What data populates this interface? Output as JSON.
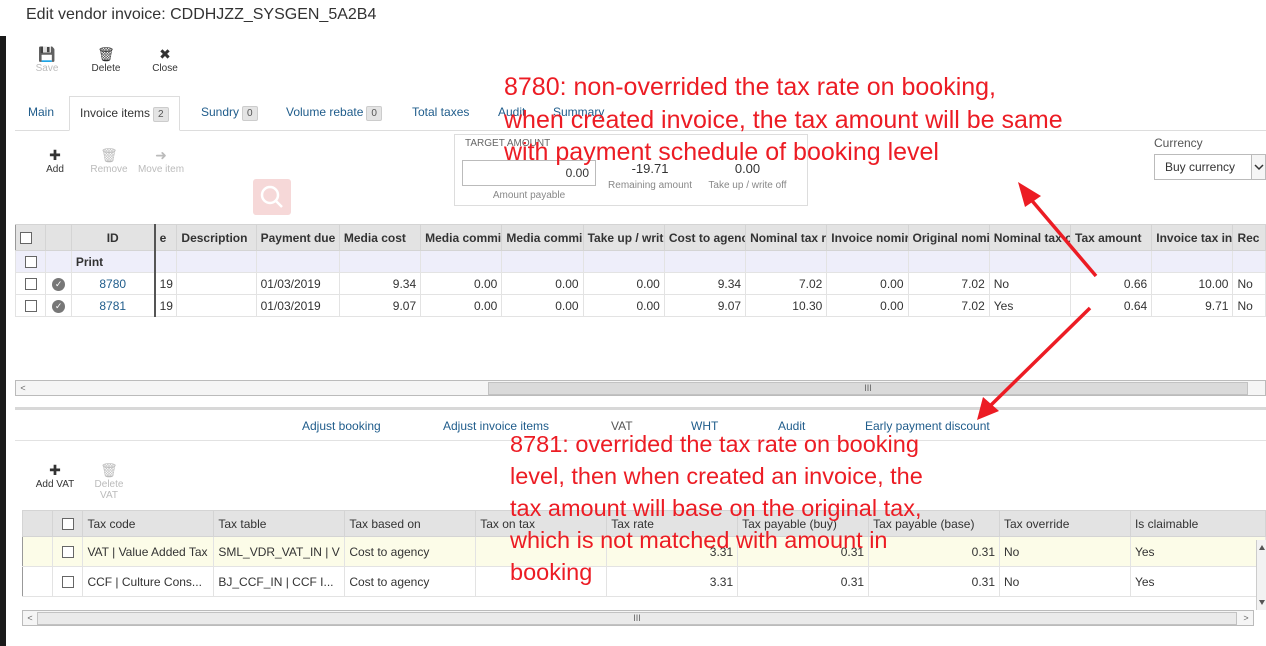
{
  "window": {
    "title": "Edit vendor invoice: CDDHJZZ_SYSGEN_5A2B4"
  },
  "toolbar": {
    "save": "Save",
    "delete": "Delete",
    "close": "Close"
  },
  "tabs": [
    {
      "label": "Main"
    },
    {
      "label": "Invoice items",
      "badge": "2"
    },
    {
      "label": "Sundry",
      "badge": "0"
    },
    {
      "label": "Volume rebate",
      "badge": "0"
    },
    {
      "label": "Total taxes"
    },
    {
      "label": "Audit"
    },
    {
      "label": "Summary"
    }
  ],
  "items_toolbar": {
    "add": "Add",
    "remove": "Remove",
    "move": "Move item"
  },
  "target": {
    "heading": "TARGET AMOUNT",
    "amount_payable_value": "0.00",
    "amount_payable_label": "Amount payable",
    "remaining_value": "-19.71",
    "remaining_label": "Remaining amount",
    "takeup_value": "0.00",
    "takeup_label": "Take up / write off"
  },
  "currency": {
    "label": "Currency",
    "selected": "Buy currency"
  },
  "grid1": {
    "headers": {
      "id": "ID",
      "e": "e",
      "description": "Description",
      "payment_due": "Payment due",
      "media_cost": "Media cost",
      "media_comm1": "Media commi",
      "media_comm2": "Media commi",
      "takeup": "Take up / writ",
      "cost_agency": "Cost to agenc",
      "nominal_tax_r": "Nominal tax r",
      "invoice_nominal": "Invoice nomir",
      "original_nominal": "Original nomi",
      "nominal_tax_o": "Nominal tax o",
      "tax_amount": "Tax amount",
      "invoice_tax_in": "Invoice tax in",
      "rec": "Rec"
    },
    "print_row": "Print",
    "rows": [
      {
        "id": "8780",
        "e": "19",
        "description": "",
        "payment_due": "01/03/2019",
        "media_cost": "9.34",
        "media_comm1": "0.00",
        "media_comm2": "0.00",
        "takeup": "0.00",
        "cost_agency": "9.34",
        "nominal_tax_r": "7.02",
        "invoice_nominal": "0.00",
        "original_nominal": "7.02",
        "nominal_tax_o": "No",
        "tax_amount": "0.66",
        "invoice_tax_in": "10.00",
        "rec": "No"
      },
      {
        "id": "8781",
        "e": "19",
        "description": "",
        "payment_due": "01/03/2019",
        "media_cost": "9.07",
        "media_comm1": "0.00",
        "media_comm2": "0.00",
        "takeup": "0.00",
        "cost_agency": "9.07",
        "nominal_tax_r": "10.30",
        "invoice_nominal": "0.00",
        "original_nominal": "7.02",
        "nominal_tax_o": "Yes",
        "tax_amount": "0.64",
        "invoice_tax_in": "9.71",
        "rec": "No"
      }
    ]
  },
  "subtabs": [
    "Adjust booking",
    "Adjust invoice items",
    "VAT",
    "WHT",
    "Audit",
    "Early payment discount"
  ],
  "vat_toolbar": {
    "add": "Add VAT",
    "delete": "Delete VAT"
  },
  "grid2": {
    "headers": {
      "tax_code": "Tax code",
      "tax_table": "Tax table",
      "tax_based_on": "Tax based on",
      "tax_on_tax": "Tax on tax",
      "tax_rate": "Tax rate",
      "tax_payable_buy": "Tax payable (buy)",
      "tax_payable_base": "Tax payable (base)",
      "tax_override": "Tax override",
      "is_claimable": "Is claimable"
    },
    "rows": [
      {
        "tax_code": "VAT | Value Added Tax",
        "tax_table": "SML_VDR_VAT_IN | V",
        "tax_based_on": "Cost to agency",
        "tax_on_tax": "",
        "tax_rate": "3.31",
        "tax_payable_buy": "0.31",
        "tax_payable_base": "0.31",
        "tax_override": "No",
        "is_claimable": "Yes"
      },
      {
        "tax_code": "CCF | Culture Cons...",
        "tax_table": "BJ_CCF_IN | CCF I...",
        "tax_based_on": "Cost to agency",
        "tax_on_tax": "",
        "tax_rate": "3.31",
        "tax_payable_buy": "0.31",
        "tax_payable_base": "0.31",
        "tax_override": "No",
        "is_claimable": "Yes"
      }
    ]
  },
  "annotations": {
    "a1": [
      "8780: non-overrided the tax rate on booking,",
      "when created invoice, the tax amount will be same",
      "with payment schedule of booking level"
    ],
    "a2": [
      "8781: overrided the tax rate on booking",
      "level, then when created an invoice, the",
      "tax amount will base on the original tax,",
      "which is not matched with amount in",
      "booking"
    ]
  },
  "colors": {
    "annotation": "#ec1c24",
    "link": "#1f5c8b",
    "header_bg": "#e3e3e3"
  }
}
